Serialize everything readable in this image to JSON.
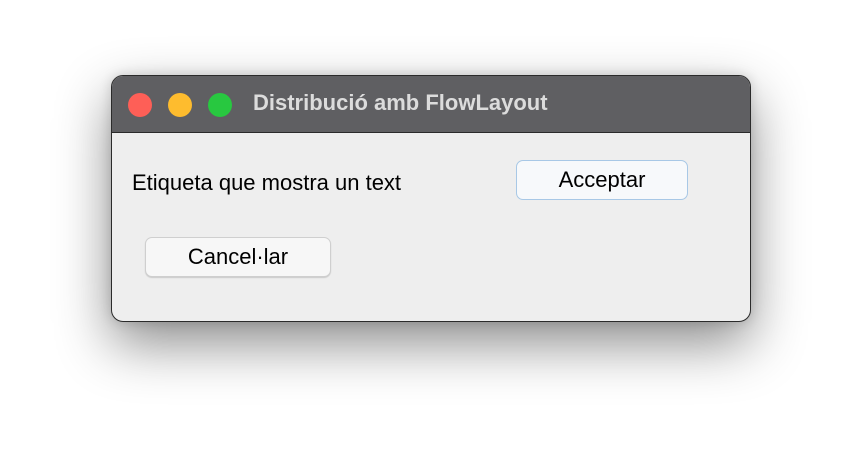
{
  "window": {
    "title": "Distribució amb FlowLayout"
  },
  "content": {
    "label": "Etiqueta que mostra un text",
    "accept_label": "Acceptar",
    "cancel_label": "Cancel·lar"
  },
  "colors": {
    "close": "#fe5f57",
    "minimize": "#febc2e",
    "maximize": "#28c840",
    "titlebar": "#5f5f62"
  }
}
